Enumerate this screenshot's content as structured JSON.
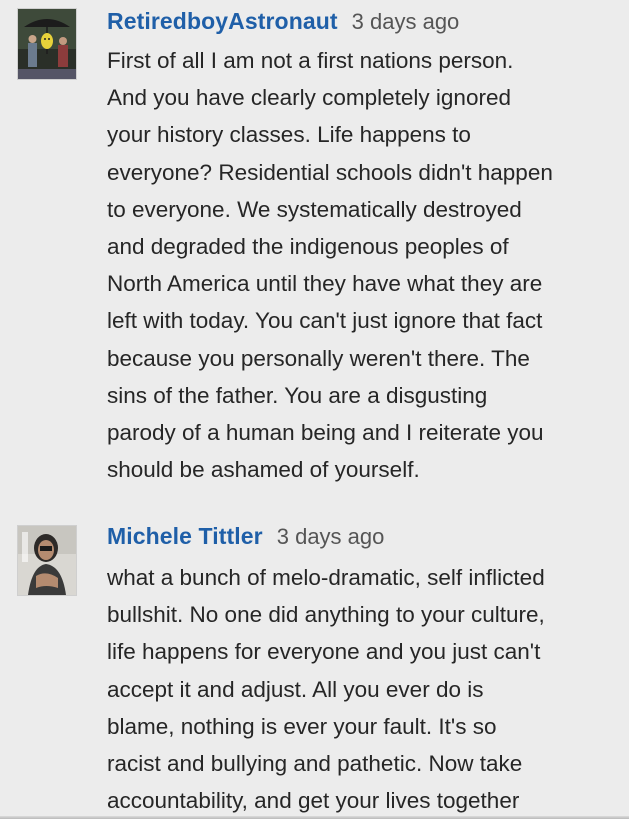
{
  "comments": [
    {
      "author": "RetiredboyAstronaut",
      "timestamp": "3 days ago",
      "avatar_icon": "avatar-photo-umbrella",
      "lines": [
        "First of all I am not a first nations person.",
        "And you have clearly completely ignored",
        "your history classes. Life happens to",
        "everyone? Residential schools didn't happen",
        "to everyone. We systematically destroyed",
        "and degraded the indigenous peoples of",
        "North America until they have what they are",
        "left with today. You can't just ignore that fact",
        "because you personally weren't there. The",
        "sins of the father. You are a disgusting",
        "parody of a human being and I reiterate you",
        "should be ashamed of yourself."
      ]
    },
    {
      "author": "Michele Tittler",
      "timestamp": "3 days ago",
      "avatar_icon": "avatar-photo-woman",
      "lines": [
        "what a bunch of melo-dramatic, self inflicted",
        "bullshit. No one did anything to your culture,",
        "life happens for everyone and you just can't",
        "accept it and adjust. All you ever do is",
        "blame, nothing is ever your fault. It's so",
        "racist and bullying and pathetic. Now take",
        "accountability, and get your lives together"
      ]
    }
  ],
  "colors": {
    "background": "#ececec",
    "author": "#1f5fa8",
    "timestamp": "#555555",
    "body": "#262626"
  }
}
